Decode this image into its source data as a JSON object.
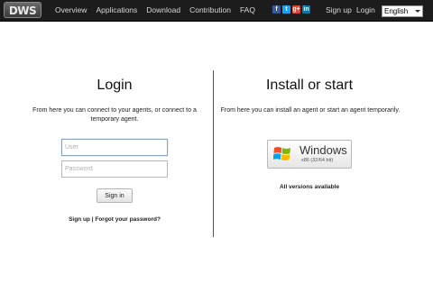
{
  "header": {
    "logo_text": "DWS",
    "nav": [
      "Overview",
      "Applications",
      "Download",
      "Contribution",
      "FAQ"
    ],
    "social_icons": [
      "facebook-icon",
      "twitter-icon",
      "google-plus-icon",
      "linkedin-icon"
    ],
    "social_glyphs": [
      "f",
      "t",
      "g+",
      "in"
    ],
    "signup_label": "Sign up",
    "login_label": "Login",
    "language_selected": "English"
  },
  "login": {
    "title": "Login",
    "description": "From here you can connect to your agents, or connect to a temporary agent.",
    "user_placeholder": "User",
    "password_placeholder": "Password",
    "signin_label": "Sign in",
    "signup_link": "Sign up",
    "separator": " | ",
    "forgot_link": "Forgot your password?"
  },
  "install": {
    "title": "Install or start",
    "description": "From here you can install an agent or start an agent temporarily.",
    "windows_label": "Windows",
    "windows_sub": "x86 (32/64 bit)",
    "all_versions_label": "All versions available"
  },
  "colors": {
    "topbar": "#1c1c1c",
    "win_red": "#f25022",
    "win_green": "#7fba00",
    "win_blue": "#00a4ef",
    "win_yellow": "#ffb900"
  }
}
